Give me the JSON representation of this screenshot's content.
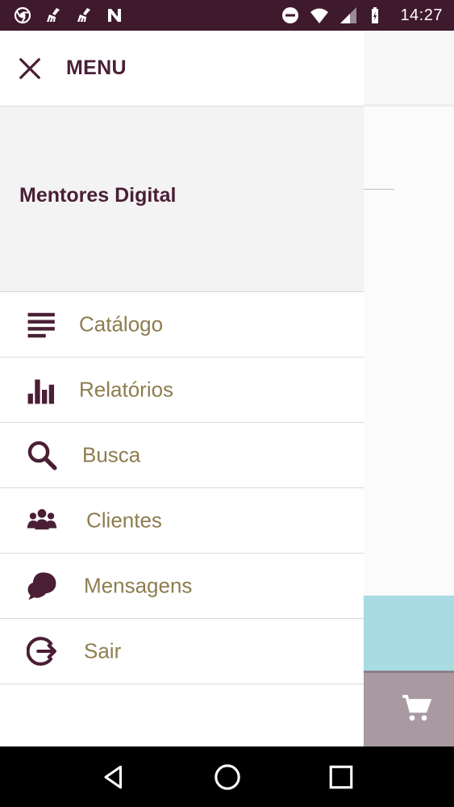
{
  "status_bar": {
    "time": "14:27",
    "left_icons": [
      "chrome-icon",
      "cleaner-icon",
      "cleaner-icon",
      "n-app-icon"
    ],
    "right_icons": [
      "do-not-disturb-icon",
      "wifi-icon",
      "signal-icon",
      "battery-charging-icon"
    ]
  },
  "drawer": {
    "title": "MENU",
    "profile_name": "Mentores Digital",
    "items": [
      {
        "label": "Catálogo",
        "icon": "list-icon"
      },
      {
        "label": "Relatórios",
        "icon": "bar-chart-icon"
      },
      {
        "label": "Busca",
        "icon": "search-icon"
      },
      {
        "label": "Clientes",
        "icon": "people-icon"
      },
      {
        "label": "Mensagens",
        "icon": "chat-bubble-icon"
      },
      {
        "label": "Sair",
        "icon": "logout-icon"
      }
    ]
  },
  "background": {
    "cart_icon": "cart-icon"
  },
  "colors": {
    "status_bar": "#3f1a2d",
    "primary_text": "#4a1f36",
    "menu_label": "#8e7d4f",
    "icon": "#4a1f36",
    "teal": "#a8dbe2",
    "cart_bar": "#a99aa2"
  },
  "nav_bar": {
    "buttons": [
      "back-icon",
      "home-icon",
      "recents-icon"
    ]
  }
}
